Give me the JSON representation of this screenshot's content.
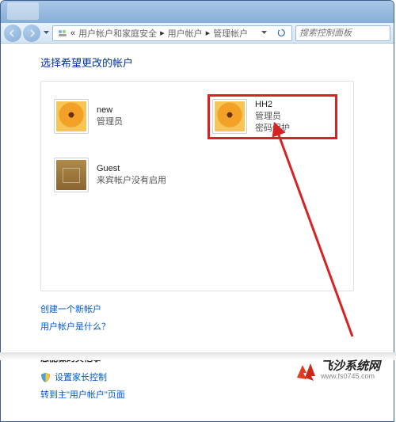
{
  "nav": {
    "breadcrumb": [
      "用户帐户和家庭安全",
      "用户帐户",
      "管理帐户"
    ],
    "search_placeholder": "搜索控制面板"
  },
  "main": {
    "heading": "选择希望更改的帐户"
  },
  "accounts": [
    {
      "name": "new",
      "role": "管理员",
      "extra": "",
      "avatar": "flower"
    },
    {
      "name": "HH2",
      "role": "管理员",
      "extra": "密码保护",
      "avatar": "flower",
      "highlighted": true
    },
    {
      "name": "Guest",
      "role": "来宾帐户没有启用",
      "extra": "",
      "avatar": "suitcase"
    }
  ],
  "links": {
    "create": "创建一个新帐户",
    "whatis": "用户帐户是什么？"
  },
  "other": {
    "heading": "您能做的其他事",
    "parental": "设置家长控制",
    "goto_main": "转到主\"用户帐户\"页面"
  },
  "watermark": {
    "title": "飞沙系统网",
    "url": "www.fs0745.com"
  }
}
